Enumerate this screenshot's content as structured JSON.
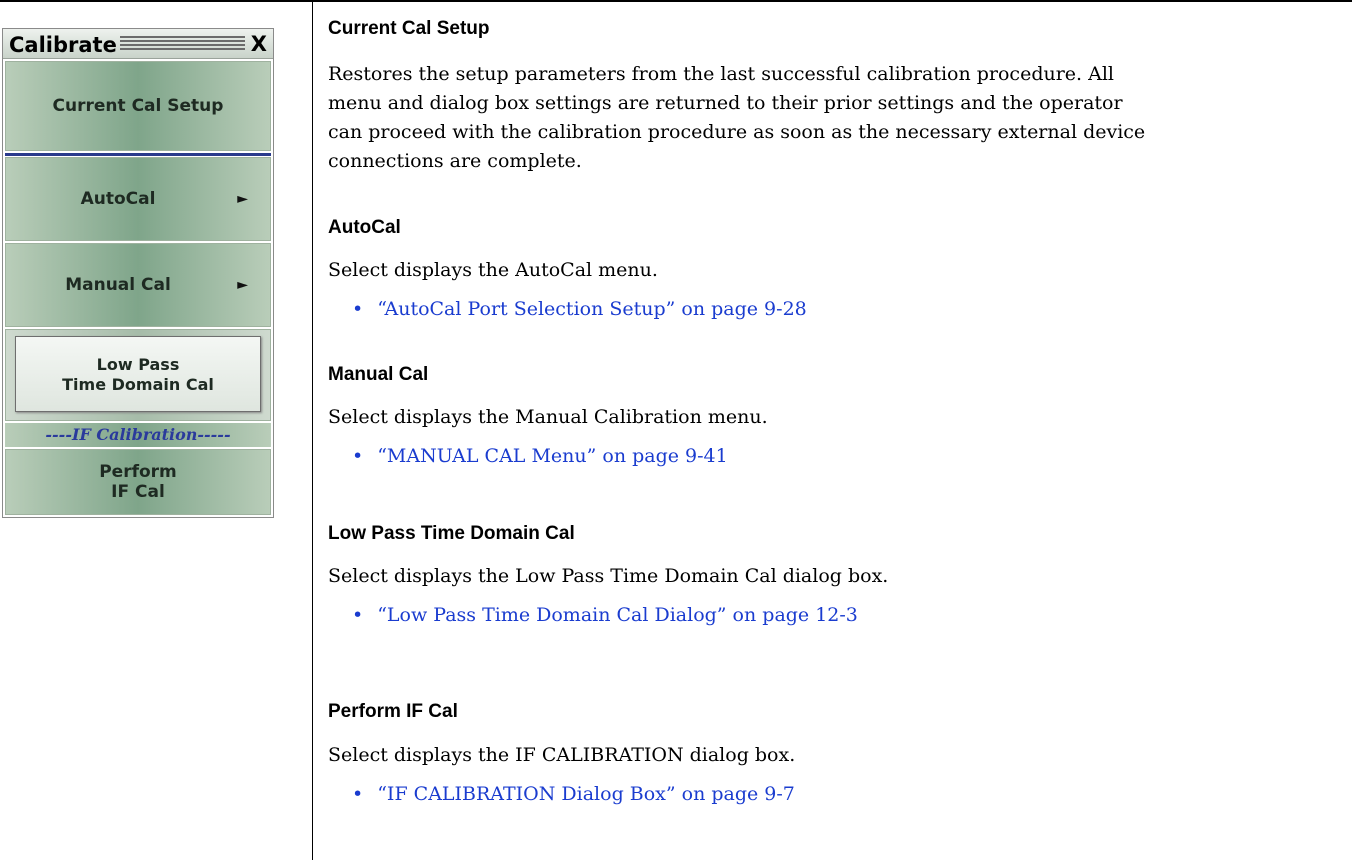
{
  "menu": {
    "title": "Calibrate",
    "close_label": "X",
    "items": {
      "current_cal_setup": "Current Cal Setup",
      "autocal": "AutoCal",
      "manual_cal": "Manual Cal",
      "low_pass_line1": "Low Pass",
      "low_pass_line2": "Time Domain Cal",
      "if_separator": "----IF Calibration-----",
      "perform_line1": "Perform",
      "perform_line2": "IF Cal"
    },
    "arrow_glyph": "►"
  },
  "sections": {
    "current": {
      "heading": "Current Cal Setup",
      "lines": [
        "Restores the setup parameters from the last successful calibration procedure. All",
        "menu and dialog box settings are returned to their prior settings and the operator",
        "can proceed with the calibration procedure as soon as the necessary external device",
        "connections are complete."
      ]
    },
    "autocal": {
      "heading": "AutoCal",
      "text": "Select displays the AutoCal menu.",
      "link": "“AutoCal Port Selection Setup” on page 9-28"
    },
    "manual": {
      "heading": "Manual Cal",
      "text": "Select displays the Manual Calibration menu.",
      "link": "“MANUAL CAL Menu” on page 9-41"
    },
    "lowpass": {
      "heading": "Low Pass Time Domain Cal",
      "text": "Select displays the Low Pass Time Domain Cal dialog box.",
      "link": "“Low Pass Time Domain Cal Dialog” on page 12-3"
    },
    "perform": {
      "heading": "Perform IF Cal",
      "text": "Select displays the IF CALIBRATION dialog box.",
      "link": "“IF CALIBRATION Dialog Box” on page 9-7"
    }
  },
  "colors": {
    "link": "#1a3ccf",
    "menu_button": "#7fa58a",
    "separator_blue": "#2a3a8c"
  }
}
